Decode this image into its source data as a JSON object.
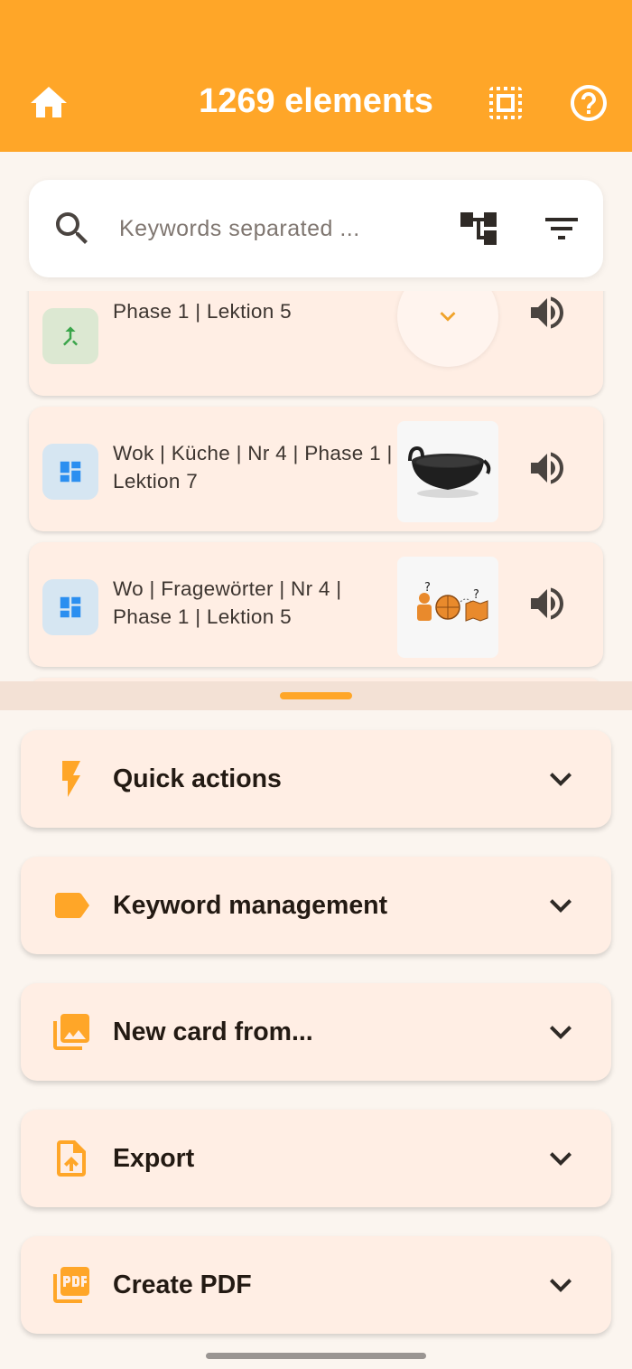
{
  "header": {
    "title": "1269 elements",
    "home_icon": "home-icon",
    "select_icon": "select-all-icon",
    "help_icon": "help-icon"
  },
  "search": {
    "placeholder": "Keywords separated ...",
    "value": ""
  },
  "cards": [
    {
      "label": "Phase 1 | Lektion 5",
      "type": "merge",
      "badge_color": "#dce8d2"
    },
    {
      "label": "Wok | Küche | Nr 4 | Phase 1 | Lektion 7",
      "type": "dashboard",
      "badge_color": "#d6e6f2",
      "image": "wok"
    },
    {
      "label": "Wo | Fragewörter | Nr 4 | Phase 1 | Lektion 5",
      "type": "dashboard",
      "badge_color": "#d6e6f2",
      "image": "where-question"
    }
  ],
  "panels": [
    {
      "title": "Quick actions",
      "icon": "bolt-icon"
    },
    {
      "title": "Keyword management",
      "icon": "label-icon"
    },
    {
      "title": "New card from...",
      "icon": "photo-library-icon"
    },
    {
      "title": "Export",
      "icon": "upload-file-icon"
    },
    {
      "title": "Create PDF",
      "icon": "pdf-icon"
    }
  ],
  "colors": {
    "accent": "#ffa628",
    "card_bg": "#ffeee4",
    "page_bg": "#fbf5ef",
    "icon_dark": "#4a4440"
  }
}
